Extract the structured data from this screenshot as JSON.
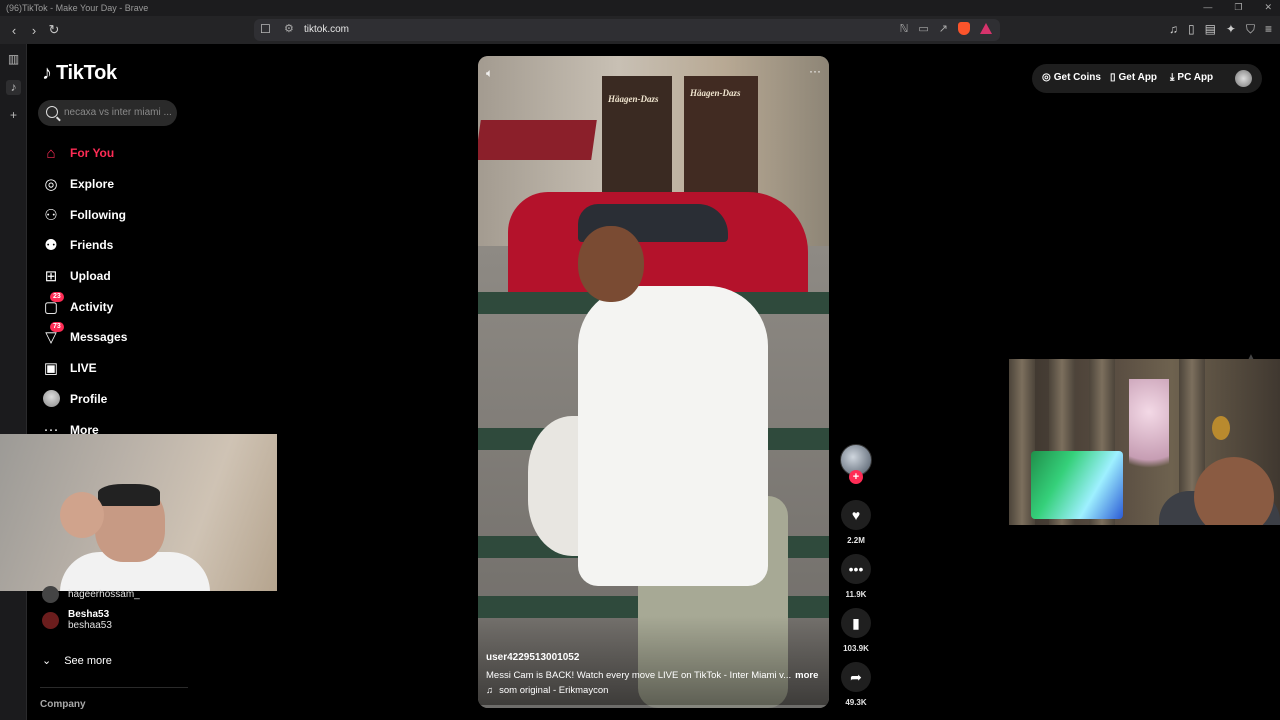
{
  "browser": {
    "window_title": "(96)TikTok - Make Your Day - Brave",
    "url": "tiktok.com"
  },
  "sidebar": {
    "logo_text": "TikTok",
    "search_placeholder": "necaxa vs inter miami ...",
    "nav": [
      {
        "label": "For You",
        "icon": "home-icon",
        "active": true
      },
      {
        "label": "Explore",
        "icon": "compass-icon"
      },
      {
        "label": "Following",
        "icon": "following-icon"
      },
      {
        "label": "Friends",
        "icon": "friends-icon"
      },
      {
        "label": "Upload",
        "icon": "upload-icon"
      },
      {
        "label": "Activity",
        "icon": "activity-icon",
        "badge": "23"
      },
      {
        "label": "Messages",
        "icon": "messages-icon",
        "badge": "73"
      },
      {
        "label": "LIVE",
        "icon": "live-icon"
      },
      {
        "label": "Profile",
        "icon": "profile-avatar"
      },
      {
        "label": "More",
        "icon": "more-icon"
      }
    ],
    "following_accounts": [
      {
        "display": "",
        "handle": "hageerhossam_"
      },
      {
        "display": "Besha53",
        "handle": "beshaa53"
      }
    ],
    "see_more": "See more",
    "footer_heading": "Company"
  },
  "video": {
    "author": "user4229513001052",
    "description": "Messi Cam is BACK! Watch every move LIVE on TikTok - Inter Miami v...",
    "more_label": "more",
    "sound": "som original - Erikmaycon",
    "shop_signs": [
      "Häagen-Dazs",
      "Häagen-Dazs"
    ]
  },
  "actions": {
    "likes": "2.2M",
    "comments": "11.9K",
    "saves": "103.9K",
    "shares": "49.3K"
  },
  "top_actions": {
    "get_coins": "Get Coins",
    "get_app": "Get App",
    "pc_app": "PC App"
  },
  "colors": {
    "accent": "#fe2c55",
    "background": "#000000",
    "panel": "#1e1e1e"
  }
}
